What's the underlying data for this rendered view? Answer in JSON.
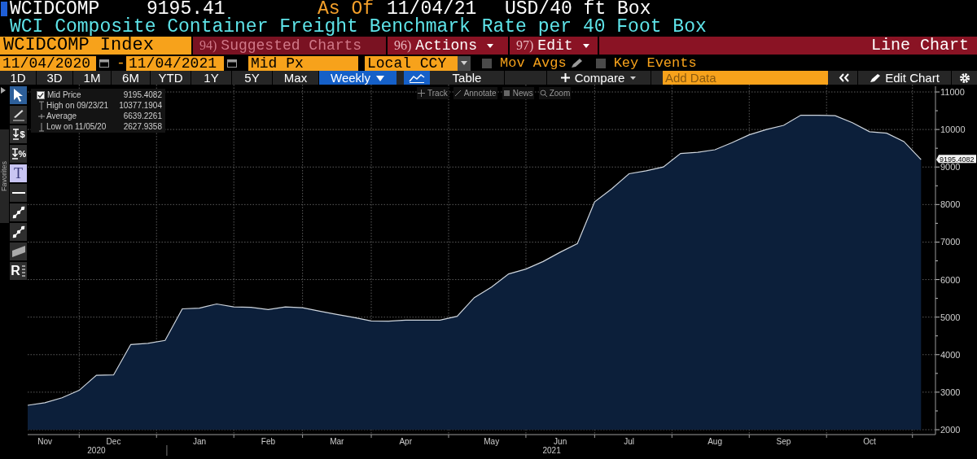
{
  "header": {
    "ticker": "WCIDCOMP",
    "price": "9195.41",
    "as_of_label": "As Of",
    "as_of_date": "11/04/21",
    "unit": "USD/40 ft Box",
    "description": "WCI Composite Container Freight Benchmark Rate per 40 Foot Box"
  },
  "menu_bar": {
    "security": "WCIDCOMP Index",
    "items": [
      {
        "number": "94)",
        "label": "Suggested Charts",
        "disabled": true,
        "dropdown": false
      },
      {
        "number": "96)",
        "label": "Actions",
        "disabled": false,
        "dropdown": true
      },
      {
        "number": "97)",
        "label": "Edit",
        "disabled": false,
        "dropdown": true
      }
    ],
    "title": "Line Chart"
  },
  "settings": {
    "start_date": "11/04/2020",
    "separator": "-",
    "end_date": "11/04/2021",
    "field": "Mid Px",
    "currency": "Local CCY",
    "toggles": [
      {
        "label": "Mov Avgs",
        "checked": false,
        "editable": true
      },
      {
        "label": "Key Events",
        "checked": false,
        "editable": false
      }
    ]
  },
  "toolbar": {
    "ranges": [
      {
        "label": "1D",
        "selected": false
      },
      {
        "label": "3D",
        "selected": false
      },
      {
        "label": "1M",
        "selected": false
      },
      {
        "label": "6M",
        "selected": false
      },
      {
        "label": "YTD",
        "selected": false
      },
      {
        "label": "1Y",
        "selected": false
      },
      {
        "label": "5Y",
        "selected": false
      },
      {
        "label": "Max",
        "selected": false
      }
    ],
    "frequency": "Weekly",
    "table": "Table",
    "compare": "Compare",
    "add_data": {
      "placeholder": "Add Data"
    },
    "edit_chart": "Edit Chart"
  },
  "chart_modes": [
    {
      "kind": "track",
      "label": "Track"
    },
    {
      "kind": "annotate",
      "label": "Annotate"
    },
    {
      "kind": "news",
      "label": "News"
    },
    {
      "kind": "zoom",
      "label": "Zoom"
    }
  ],
  "sidebar_tab": "Favorites",
  "drawing_tools": [
    {
      "kind": "pointer",
      "selected": true
    },
    {
      "kind": "pen",
      "selected": false
    },
    {
      "kind": "price_marker",
      "glyph": "$",
      "selected": false
    },
    {
      "kind": "price_marker",
      "glyph": "%",
      "selected": false
    },
    {
      "kind": "text",
      "glyph": "T",
      "selected": true
    },
    {
      "kind": "line",
      "selected": false
    },
    {
      "kind": "trend",
      "selected": false
    },
    {
      "kind": "trend",
      "selected": false
    },
    {
      "kind": "channel",
      "selected": false
    },
    {
      "kind": "legend",
      "glyph": "R",
      "selected": false
    }
  ],
  "legend": [
    {
      "kind": "series",
      "value": "9195.4082",
      "checked": true
    },
    {
      "kind": "high",
      "label": "High on 09/23/21",
      "value": "10377.1904"
    },
    {
      "kind": "average",
      "label": "Average",
      "value": "6639.2261"
    },
    {
      "kind": "low",
      "label": "Low on 11/05/20",
      "value": "2627.9358"
    }
  ],
  "last_price_label": "9195.4082",
  "year_labels": [
    "2020",
    "2021"
  ],
  "chart_data": {
    "type": "area",
    "categories": [
      null,
      "Nov",
      null,
      null,
      null,
      "Dec",
      null,
      null,
      null,
      null,
      "Jan",
      null,
      null,
      null,
      "Feb",
      null,
      null,
      null,
      "Mar",
      null,
      null,
      null,
      "Apr",
      null,
      null,
      null,
      null,
      "May",
      null,
      null,
      null,
      "Jun",
      null,
      null,
      null,
      "Jul",
      null,
      null,
      null,
      null,
      "Aug",
      null,
      null,
      null,
      "Sep",
      null,
      null,
      null,
      null,
      "Oct",
      null,
      null,
      null
    ],
    "series": [
      {
        "name": "Mid Price",
        "color": "#cfd6de",
        "values": [
          2650,
          2720,
          2850,
          3050,
          3450,
          3460,
          4270,
          4300,
          4380,
          5220,
          5240,
          5350,
          5270,
          5260,
          5200,
          5270,
          5250,
          5160,
          5070,
          4990,
          4900,
          4890,
          4920,
          4920,
          4920,
          5020,
          5520,
          5800,
          6150,
          6280,
          6480,
          6730,
          6960,
          8070,
          8420,
          8820,
          8900,
          9000,
          9360,
          9390,
          9460,
          9650,
          9860,
          10000,
          10110,
          10380,
          10380,
          10370,
          10180,
          9940,
          9900,
          9680,
          9195
        ]
      }
    ],
    "grid": true,
    "ylim": [
      2000,
      11000
    ],
    "yticks": [
      2000,
      3000,
      4000,
      5000,
      6000,
      7000,
      8000,
      9000,
      10000,
      11000
    ]
  }
}
